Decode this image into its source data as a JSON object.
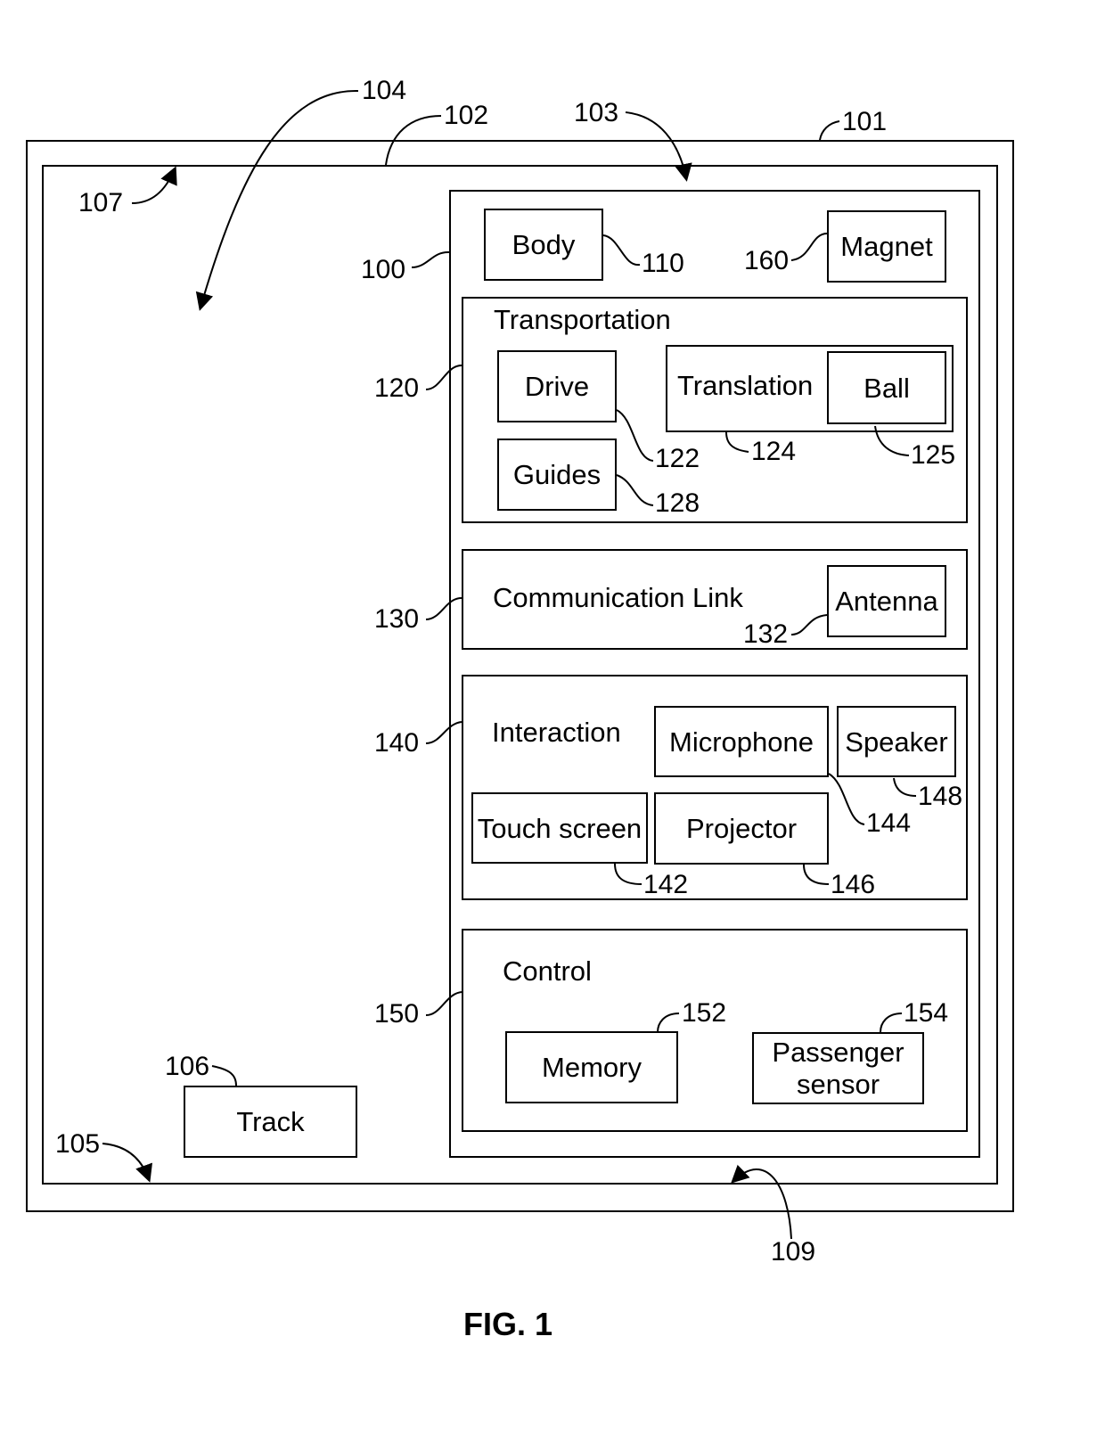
{
  "figure_title": "FIG. 1",
  "system": {
    "outer_frame_ref": "101",
    "inner_frame_ref": "102",
    "arrow_refs": {
      "r103": "103",
      "r104": "104",
      "r105": "105",
      "r107": "107",
      "r109": "109"
    },
    "track": {
      "label": "Track",
      "ref": "106"
    }
  },
  "device": {
    "ref": "100",
    "body": {
      "label": "Body",
      "ref": "110"
    },
    "magnet": {
      "label": "Magnet",
      "ref": "160"
    },
    "transportation": {
      "label": "Transportation",
      "ref": "120",
      "drive": {
        "label": "Drive",
        "ref": "122"
      },
      "guides": {
        "label": "Guides",
        "ref": "128"
      },
      "translation": {
        "label": "Translation",
        "ref": "124"
      },
      "ball": {
        "label": "Ball",
        "ref": "125"
      }
    },
    "communication": {
      "label": "Communication Link",
      "ref": "130",
      "antenna": {
        "label": "Antenna",
        "ref": "132"
      }
    },
    "interaction": {
      "label": "Interaction",
      "ref": "140",
      "microphone": {
        "label": "Microphone",
        "ref": "144"
      },
      "speaker": {
        "label": "Speaker",
        "ref": "148"
      },
      "touch_screen": {
        "label": "Touch screen",
        "ref": "142"
      },
      "projector": {
        "label": "Projector",
        "ref": "146"
      }
    },
    "control": {
      "label": "Control",
      "ref": "150",
      "memory": {
        "label": "Memory",
        "ref": "152"
      },
      "passenger_sensor": {
        "label": "Passenger sensor",
        "ref": "154"
      }
    }
  }
}
